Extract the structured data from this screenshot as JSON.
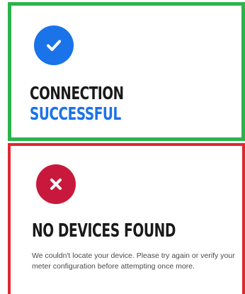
{
  "success_card": {
    "icon": "checkmark-icon",
    "title_line1": "CONNECTION",
    "title_line2": "SUCCESSFUL",
    "accent_color": "#1a73e8",
    "border_color": "#2db34a"
  },
  "error_card": {
    "icon": "close-icon",
    "title": "NO DEVICES FOUND",
    "message": "We couldn't locate your device. Please try again or verify your meter configuration before attempting once more.",
    "icon_color": "#c8193c",
    "border_color": "#e0282f"
  }
}
